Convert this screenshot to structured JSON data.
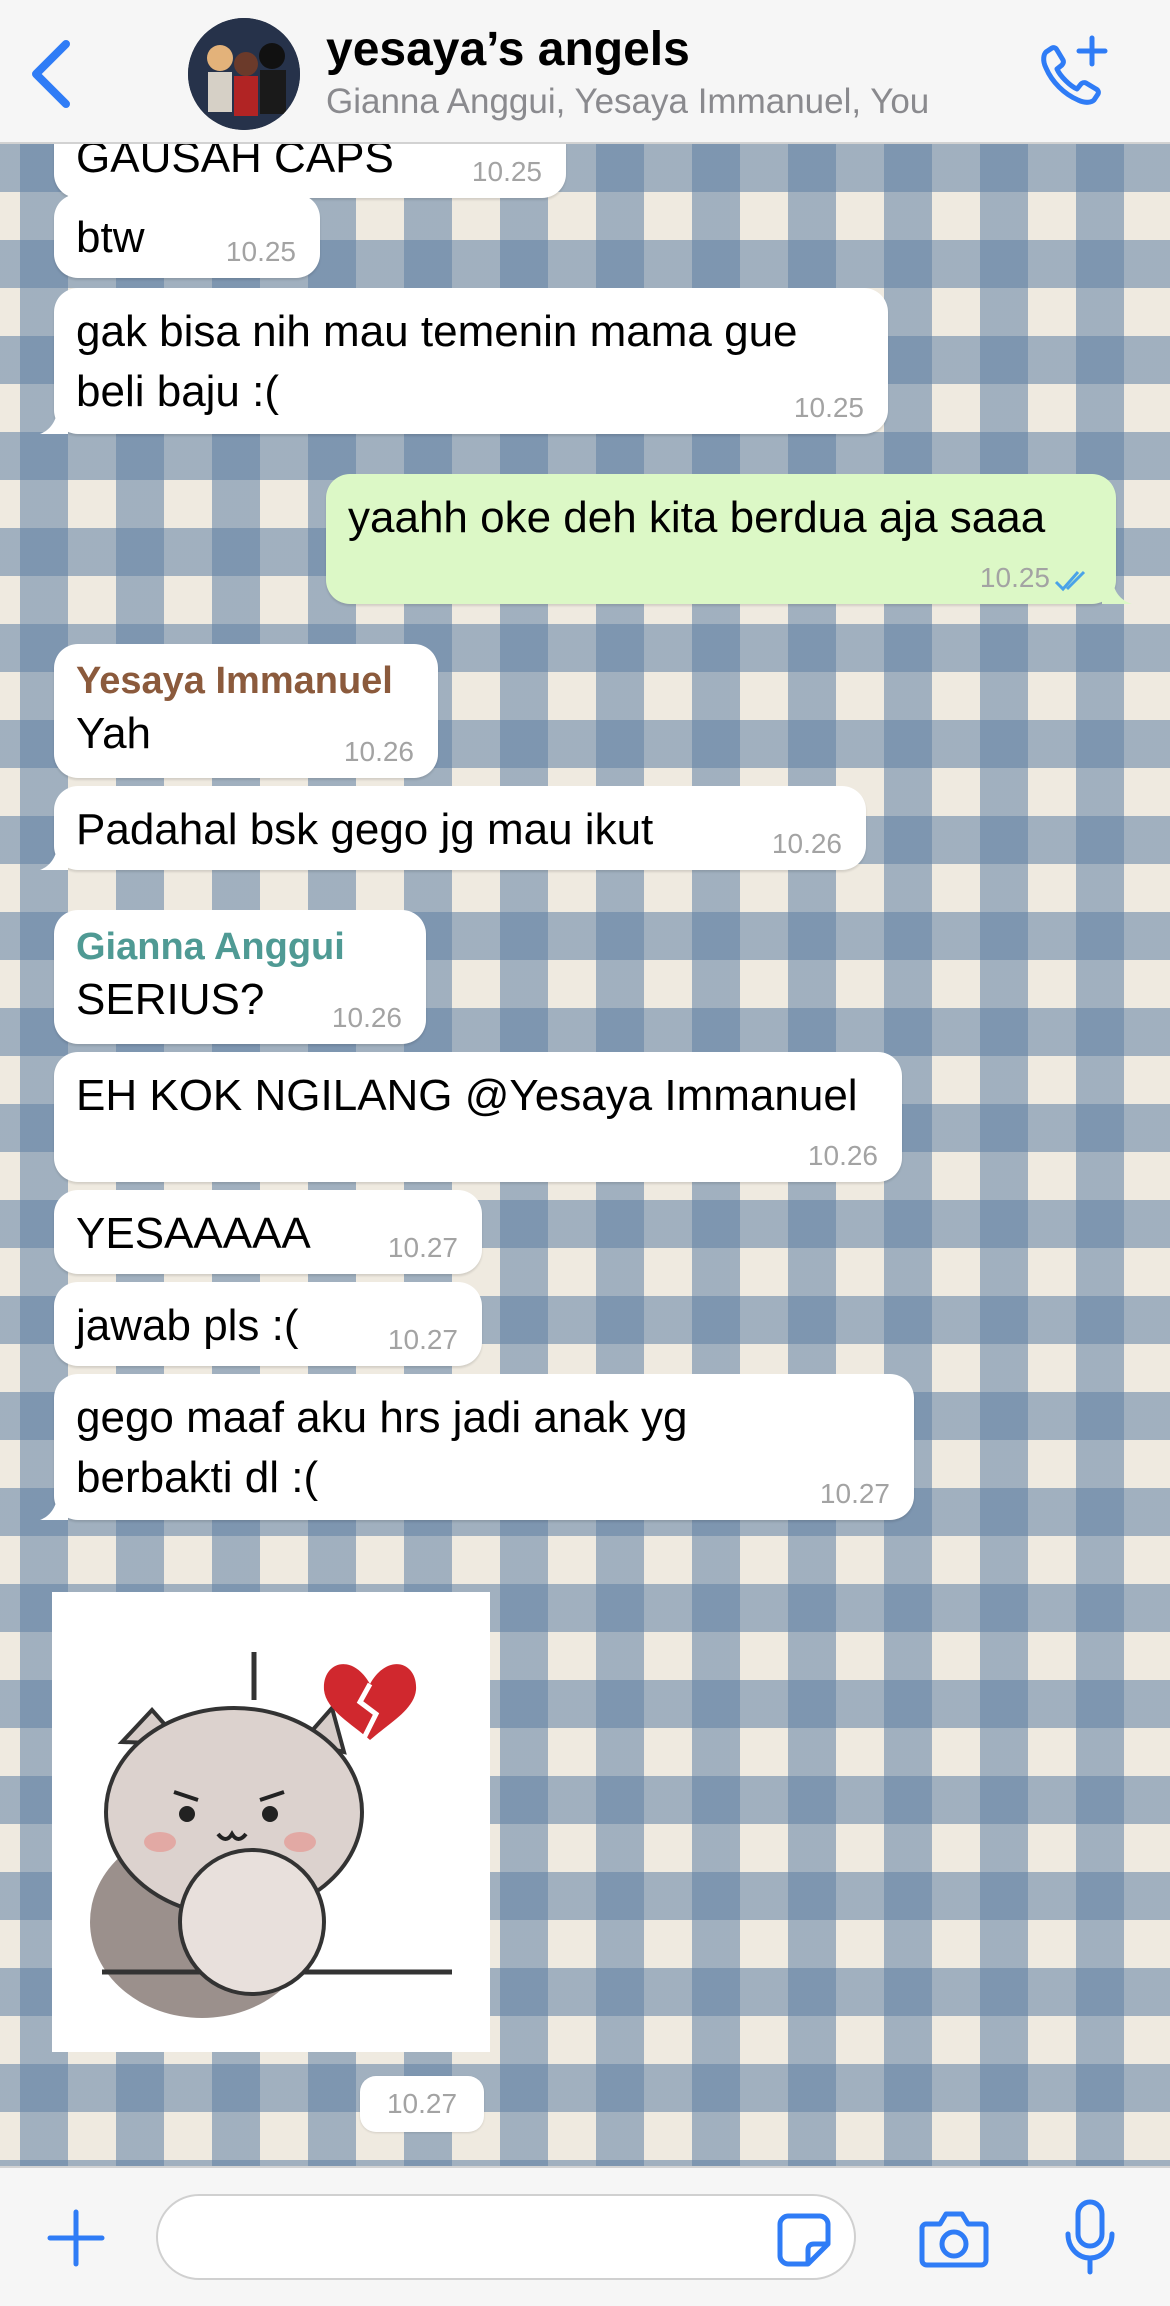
{
  "header": {
    "title": "yesaya’s angels",
    "subtitle": "Gianna Anggui, Yesaya Immanuel, You",
    "back_icon": "chevron-left-icon",
    "call_icon": "phone-plus-icon",
    "accent_color": "#2f7cf6"
  },
  "messages": [
    {
      "text": "GAUSAH CAPS",
      "time": "10.25"
    },
    {
      "text": "btw",
      "time": "10.25"
    },
    {
      "text": "gak bisa nih mau temenin mama gue\nbeli baju :(",
      "time": "10.25"
    },
    {
      "text": "yaahh oke deh kita berdua aja saaa",
      "time": "10.25",
      "status": "read-ticks"
    },
    {
      "sender": "Yesaya Immanuel",
      "sender_color": "#8b5a3c",
      "text": "Yah",
      "time": "10.26"
    },
    {
      "text": "Padahal bsk gego jg mau ikut",
      "time": "10.26"
    },
    {
      "sender": "Gianna Anggui",
      "sender_color": "#4f9a94",
      "text": "SERIUS?",
      "time": "10.26"
    },
    {
      "text": "EH KOK NGILANG @Yesaya Immanuel",
      "time": "10.26"
    },
    {
      "text": "YESAAAAA",
      "time": "10.27"
    },
    {
      "text": "jawab pls :(",
      "time": "10.27"
    },
    {
      "text": "gego maaf aku hrs jadi anak yg\nberbakti dl :(",
      "time": "10.27"
    }
  ],
  "sticker": {
    "description_icon": "sad-cat-broken-heart-sticker",
    "time": "10.27"
  },
  "footer": {
    "input_placeholder": "",
    "icons": [
      "plus-icon",
      "sticker-icon",
      "camera-icon",
      "microphone-icon"
    ]
  }
}
